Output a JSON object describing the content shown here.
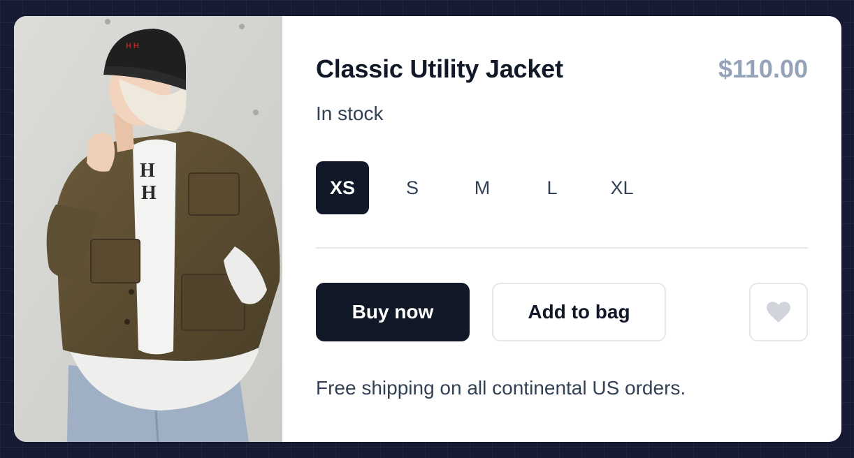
{
  "product": {
    "title": "Classic Utility Jacket",
    "price": "$110.00",
    "stock_status": "In stock",
    "image": "woman wearing olive utility jacket and black beanie"
  },
  "sizes": [
    {
      "label": "XS",
      "selected": true
    },
    {
      "label": "S",
      "selected": false
    },
    {
      "label": "M",
      "selected": false
    },
    {
      "label": "L",
      "selected": false
    },
    {
      "label": "XL",
      "selected": false
    }
  ],
  "actions": {
    "buy_label": "Buy now",
    "bag_label": "Add to bag",
    "favorite_icon": "heart-icon"
  },
  "shipping_note": "Free shipping on all continental US orders.",
  "colors": {
    "background": "#171a33",
    "card": "#ffffff",
    "primary": "#111827",
    "price": "#94a3b8",
    "muted_text": "#334155",
    "border": "#e5e7eb",
    "heart": "#d1d5db"
  }
}
